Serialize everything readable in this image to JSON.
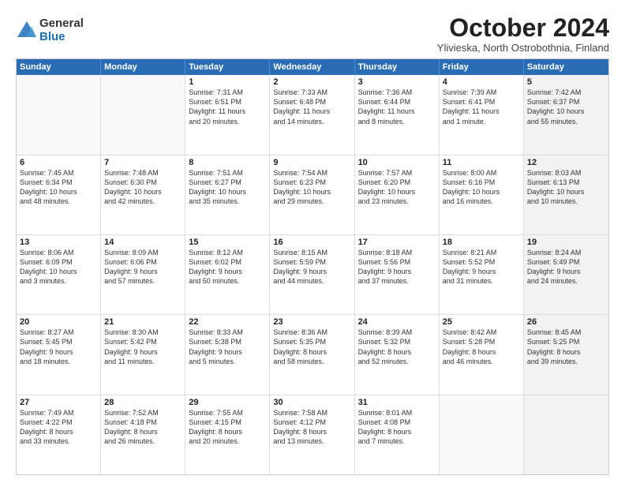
{
  "logo": {
    "general": "General",
    "blue": "Blue"
  },
  "title": "October 2024",
  "subtitle": "Ylivieska, North Ostrobothnia, Finland",
  "headers": [
    "Sunday",
    "Monday",
    "Tuesday",
    "Wednesday",
    "Thursday",
    "Friday",
    "Saturday"
  ],
  "rows": [
    [
      {
        "day": "",
        "text": "",
        "shaded": false,
        "empty": true
      },
      {
        "day": "",
        "text": "",
        "shaded": false,
        "empty": true
      },
      {
        "day": "1",
        "text": "Sunrise: 7:31 AM\nSunset: 6:51 PM\nDaylight: 11 hours\nand 20 minutes.",
        "shaded": false,
        "empty": false
      },
      {
        "day": "2",
        "text": "Sunrise: 7:33 AM\nSunset: 6:48 PM\nDaylight: 11 hours\nand 14 minutes.",
        "shaded": false,
        "empty": false
      },
      {
        "day": "3",
        "text": "Sunrise: 7:36 AM\nSunset: 6:44 PM\nDaylight: 11 hours\nand 8 minutes.",
        "shaded": false,
        "empty": false
      },
      {
        "day": "4",
        "text": "Sunrise: 7:39 AM\nSunset: 6:41 PM\nDaylight: 11 hours\nand 1 minute.",
        "shaded": false,
        "empty": false
      },
      {
        "day": "5",
        "text": "Sunrise: 7:42 AM\nSunset: 6:37 PM\nDaylight: 10 hours\nand 55 minutes.",
        "shaded": true,
        "empty": false
      }
    ],
    [
      {
        "day": "6",
        "text": "Sunrise: 7:45 AM\nSunset: 6:34 PM\nDaylight: 10 hours\nand 48 minutes.",
        "shaded": false,
        "empty": false
      },
      {
        "day": "7",
        "text": "Sunrise: 7:48 AM\nSunset: 6:30 PM\nDaylight: 10 hours\nand 42 minutes.",
        "shaded": false,
        "empty": false
      },
      {
        "day": "8",
        "text": "Sunrise: 7:51 AM\nSunset: 6:27 PM\nDaylight: 10 hours\nand 35 minutes.",
        "shaded": false,
        "empty": false
      },
      {
        "day": "9",
        "text": "Sunrise: 7:54 AM\nSunset: 6:23 PM\nDaylight: 10 hours\nand 29 minutes.",
        "shaded": false,
        "empty": false
      },
      {
        "day": "10",
        "text": "Sunrise: 7:57 AM\nSunset: 6:20 PM\nDaylight: 10 hours\nand 23 minutes.",
        "shaded": false,
        "empty": false
      },
      {
        "day": "11",
        "text": "Sunrise: 8:00 AM\nSunset: 6:16 PM\nDaylight: 10 hours\nand 16 minutes.",
        "shaded": false,
        "empty": false
      },
      {
        "day": "12",
        "text": "Sunrise: 8:03 AM\nSunset: 6:13 PM\nDaylight: 10 hours\nand 10 minutes.",
        "shaded": true,
        "empty": false
      }
    ],
    [
      {
        "day": "13",
        "text": "Sunrise: 8:06 AM\nSunset: 6:09 PM\nDaylight: 10 hours\nand 3 minutes.",
        "shaded": false,
        "empty": false
      },
      {
        "day": "14",
        "text": "Sunrise: 8:09 AM\nSunset: 6:06 PM\nDaylight: 9 hours\nand 57 minutes.",
        "shaded": false,
        "empty": false
      },
      {
        "day": "15",
        "text": "Sunrise: 8:12 AM\nSunset: 6:02 PM\nDaylight: 9 hours\nand 50 minutes.",
        "shaded": false,
        "empty": false
      },
      {
        "day": "16",
        "text": "Sunrise: 8:15 AM\nSunset: 5:59 PM\nDaylight: 9 hours\nand 44 minutes.",
        "shaded": false,
        "empty": false
      },
      {
        "day": "17",
        "text": "Sunrise: 8:18 AM\nSunset: 5:56 PM\nDaylight: 9 hours\nand 37 minutes.",
        "shaded": false,
        "empty": false
      },
      {
        "day": "18",
        "text": "Sunrise: 8:21 AM\nSunset: 5:52 PM\nDaylight: 9 hours\nand 31 minutes.",
        "shaded": false,
        "empty": false
      },
      {
        "day": "19",
        "text": "Sunrise: 8:24 AM\nSunset: 5:49 PM\nDaylight: 9 hours\nand 24 minutes.",
        "shaded": true,
        "empty": false
      }
    ],
    [
      {
        "day": "20",
        "text": "Sunrise: 8:27 AM\nSunset: 5:45 PM\nDaylight: 9 hours\nand 18 minutes.",
        "shaded": false,
        "empty": false
      },
      {
        "day": "21",
        "text": "Sunrise: 8:30 AM\nSunset: 5:42 PM\nDaylight: 9 hours\nand 11 minutes.",
        "shaded": false,
        "empty": false
      },
      {
        "day": "22",
        "text": "Sunrise: 8:33 AM\nSunset: 5:38 PM\nDaylight: 9 hours\nand 5 minutes.",
        "shaded": false,
        "empty": false
      },
      {
        "day": "23",
        "text": "Sunrise: 8:36 AM\nSunset: 5:35 PM\nDaylight: 8 hours\nand 58 minutes.",
        "shaded": false,
        "empty": false
      },
      {
        "day": "24",
        "text": "Sunrise: 8:39 AM\nSunset: 5:32 PM\nDaylight: 8 hours\nand 52 minutes.",
        "shaded": false,
        "empty": false
      },
      {
        "day": "25",
        "text": "Sunrise: 8:42 AM\nSunset: 5:28 PM\nDaylight: 8 hours\nand 46 minutes.",
        "shaded": false,
        "empty": false
      },
      {
        "day": "26",
        "text": "Sunrise: 8:45 AM\nSunset: 5:25 PM\nDaylight: 8 hours\nand 39 minutes.",
        "shaded": true,
        "empty": false
      }
    ],
    [
      {
        "day": "27",
        "text": "Sunrise: 7:49 AM\nSunset: 4:22 PM\nDaylight: 8 hours\nand 33 minutes.",
        "shaded": false,
        "empty": false
      },
      {
        "day": "28",
        "text": "Sunrise: 7:52 AM\nSunset: 4:18 PM\nDaylight: 8 hours\nand 26 minutes.",
        "shaded": false,
        "empty": false
      },
      {
        "day": "29",
        "text": "Sunrise: 7:55 AM\nSunset: 4:15 PM\nDaylight: 8 hours\nand 20 minutes.",
        "shaded": false,
        "empty": false
      },
      {
        "day": "30",
        "text": "Sunrise: 7:58 AM\nSunset: 4:12 PM\nDaylight: 8 hours\nand 13 minutes.",
        "shaded": false,
        "empty": false
      },
      {
        "day": "31",
        "text": "Sunrise: 8:01 AM\nSunset: 4:08 PM\nDaylight: 8 hours\nand 7 minutes.",
        "shaded": false,
        "empty": false
      },
      {
        "day": "",
        "text": "",
        "shaded": false,
        "empty": true
      },
      {
        "day": "",
        "text": "",
        "shaded": true,
        "empty": true
      }
    ]
  ]
}
